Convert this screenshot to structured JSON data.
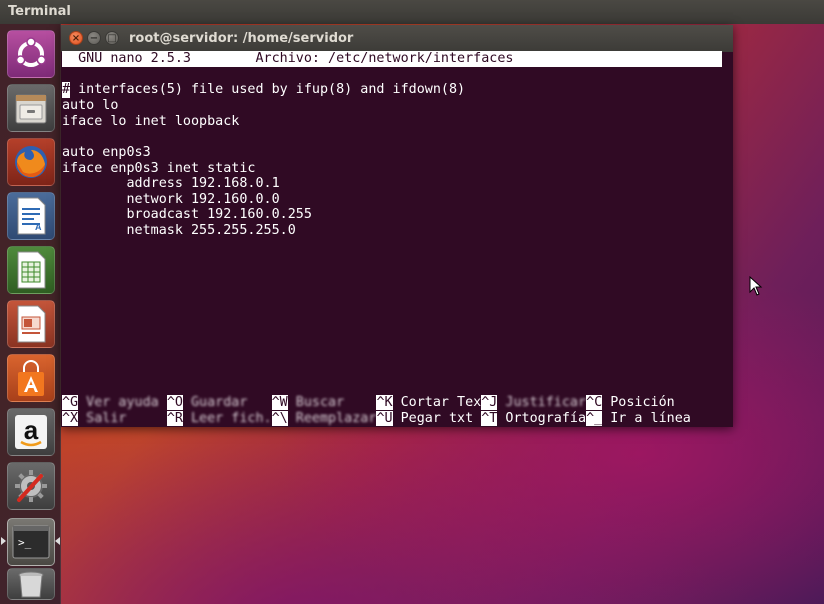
{
  "panel": {
    "title": "Terminal"
  },
  "launcher": {
    "items": [
      {
        "name": "dash",
        "icon": "ubuntu-logo-icon"
      },
      {
        "name": "files",
        "icon": "file-cabinet-icon"
      },
      {
        "name": "firefox",
        "icon": "firefox-icon"
      },
      {
        "name": "writer",
        "icon": "libreoffice-writer-icon"
      },
      {
        "name": "calc",
        "icon": "libreoffice-calc-icon"
      },
      {
        "name": "impress",
        "icon": "libreoffice-impress-icon"
      },
      {
        "name": "software-center",
        "icon": "shopping-bag-icon"
      },
      {
        "name": "amazon",
        "icon": "amazon-icon"
      },
      {
        "name": "settings",
        "icon": "settings-tools-icon"
      },
      {
        "name": "terminal",
        "icon": "terminal-icon"
      },
      {
        "name": "trash",
        "icon": "trash-icon"
      }
    ],
    "icon_texts": {
      "writer_letter": "A",
      "amazon_letter": "a",
      "terminal_prompt": ">_"
    }
  },
  "window": {
    "title": "root@servidor: /home/servidor",
    "close_glyph": "×",
    "min_glyph": "−",
    "max_glyph": "□"
  },
  "nano": {
    "header": "  GNU nano 2.5.3        Archivo: /etc/network/interfaces",
    "cursor_char": "#",
    "lines": [
      " interfaces(5) file used by ifup(8) and ifdown(8)",
      "auto lo",
      "iface lo inet loopback",
      "",
      "auto enp0s3",
      "iface enp0s3 inet static",
      "        address 192.168.0.1",
      "        network 192.160.0.0",
      "        broadcast 192.160.0.255",
      "        netmask 255.255.255.0"
    ],
    "shortcuts_row1": [
      {
        "key": "^G",
        "label": " Ver ayuda "
      },
      {
        "key": "^O",
        "label": " Guardar   "
      },
      {
        "key": "^W",
        "label": " Buscar    "
      },
      {
        "key": "^K",
        "label": " Cortar Tex"
      },
      {
        "key": "^J",
        "label": " Justificar"
      },
      {
        "key": "^C",
        "label": " Posición"
      }
    ],
    "shortcuts_row2": [
      {
        "key": "^X",
        "label": " Salir     "
      },
      {
        "key": "^R",
        "label": " Leer fich."
      },
      {
        "key": "^\\",
        "label": " Reemplazar"
      },
      {
        "key": "^U",
        "label": " Pegar txt "
      },
      {
        "key": "^T",
        "label": " Ortografía"
      },
      {
        "key": "^_",
        "label": " Ir a línea"
      }
    ]
  },
  "colors": {
    "terminal_bg": "#300a24",
    "terminal_fg": "#ffffff",
    "panel_bg": "#3c3b37",
    "close_orange": "#e0501f"
  }
}
